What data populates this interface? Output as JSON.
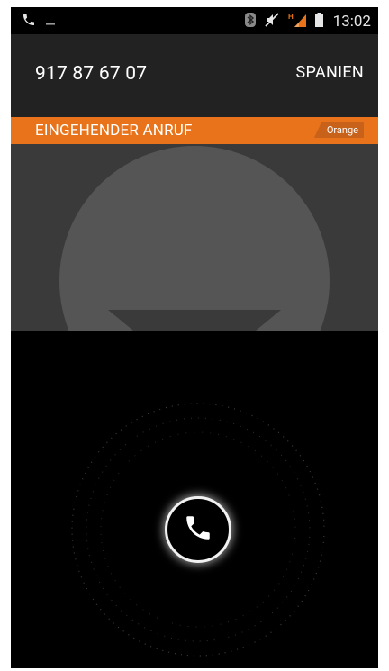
{
  "status_bar": {
    "time": "13:02",
    "icons": [
      "phone-icon",
      "notification-dash-icon",
      "bluetooth-icon",
      "mute-icon",
      "signal-icon",
      "battery-icon"
    ],
    "network_type": "H"
  },
  "caller": {
    "number": "917 87 67 07",
    "location": "SPANIEN"
  },
  "call": {
    "state": "EINGEHENDER ANRUF",
    "carrier": "Orange"
  },
  "colors": {
    "accent": "#e8731a",
    "header": "#222222",
    "photo_bg": "#3a3a3a",
    "avatar": "#555555"
  },
  "answer": {
    "icon": "phone-answer-icon"
  }
}
